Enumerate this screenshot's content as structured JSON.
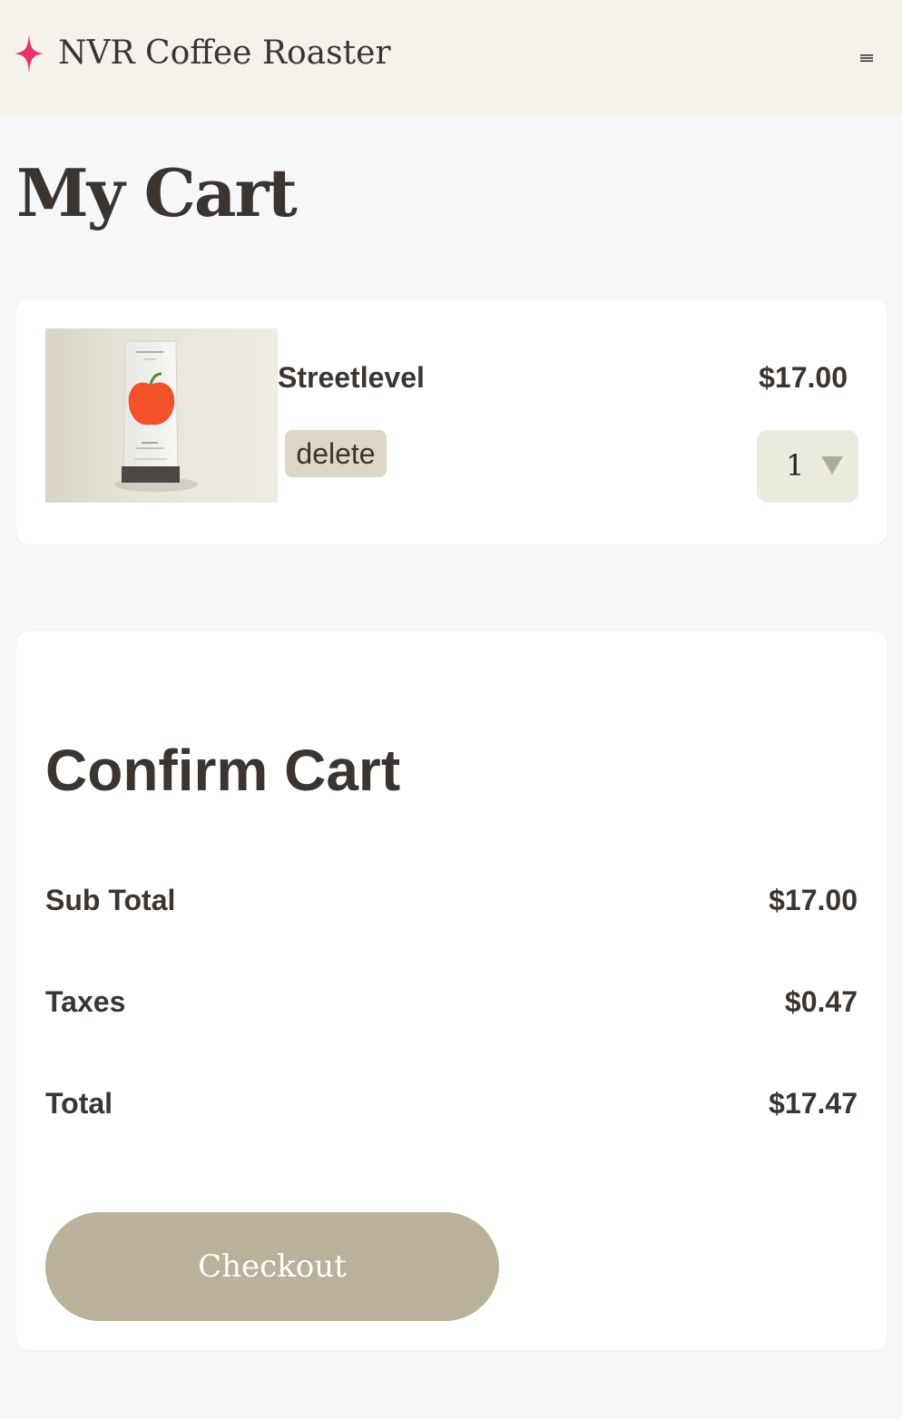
{
  "header": {
    "brand_name": "NVR Coffee Roaster",
    "brand_icon": "sparkle-star-icon",
    "menu_icon": "hamburger-menu-icon",
    "accent_color": "#e8336d"
  },
  "page": {
    "title": "My Cart"
  },
  "cart": {
    "items": [
      {
        "name": "Streetlevel",
        "price": "$17.00",
        "quantity": "1",
        "delete_label": "delete",
        "image_icon": "coffee-bag-image"
      }
    ]
  },
  "confirm": {
    "title": "Confirm Cart",
    "rows": [
      {
        "label": "Sub Total",
        "value": "$17.00"
      },
      {
        "label": "Taxes",
        "value": "$0.47"
      },
      {
        "label": "Total",
        "value": "$17.47"
      }
    ],
    "checkout_label": "Checkout",
    "checkout_color": "#b9b19a"
  }
}
